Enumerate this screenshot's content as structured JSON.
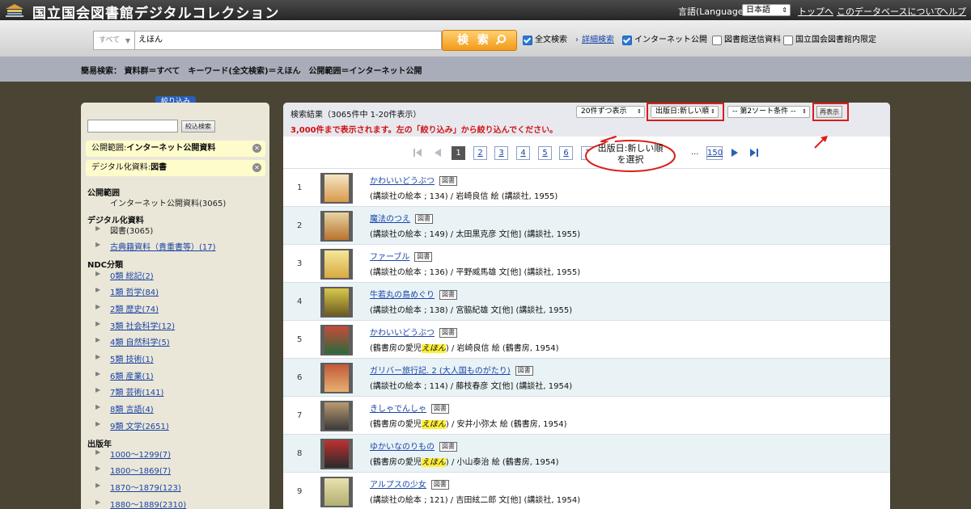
{
  "header": {
    "site_title": "国立国会図書館デジタルコレクション",
    "language_label": "言語(Language):",
    "language_value": "日本語",
    "links": [
      "トップへ",
      "このデータベースについて",
      "ヘルプ"
    ]
  },
  "search": {
    "scope": "すべて",
    "keyword": "えほん",
    "button": "検 索",
    "fulltext_label": "全文検索",
    "advanced_label": "詳細検索",
    "options": [
      {
        "label": "インターネット公開",
        "checked": true
      },
      {
        "label": "図書館送信資料",
        "checked": false
      },
      {
        "label": "国立国会図書館内限定",
        "checked": false
      }
    ]
  },
  "breadcrumb": "簡易検索： 資料群＝すべて　キーワード(全文検索)＝えほん　公開範囲＝インターネット公開",
  "sidebar": {
    "tab": "絞り込み",
    "narrow_button": "絞込検索",
    "chips": [
      {
        "prefix": "公開範囲:",
        "value": "インターネット公開資料"
      },
      {
        "prefix": "デジタル化資料:",
        "value": "図書"
      }
    ],
    "scope_heading": "公開範囲",
    "scope_item": "インターネット公開資料(3065)",
    "digital_heading": "デジタル化資料",
    "digital_items": [
      "図書(3065)",
      "古典籍資料（貴重書等）(17)"
    ],
    "ndc_heading": "NDC分類",
    "ndc_items": [
      "0類 総記(2)",
      "1類 哲学(84)",
      "2類 歴史(74)",
      "3類 社会科学(12)",
      "4類 自然科学(5)",
      "5類 技術(1)",
      "6類 産業(1)",
      "7類 芸術(141)",
      "8類 言語(4)",
      "9類 文学(2651)"
    ],
    "year_heading": "出版年",
    "year_items": [
      "1000～1299(7)",
      "1800～1869(7)",
      "1870～1879(123)",
      "1880～1889(2310)"
    ]
  },
  "results": {
    "count": "検索結果（3065件中 1-20件表示）",
    "warning": "3,000件まで表示されます。左の「絞り込み」から絞り込んでください。",
    "per_page": "20件ずつ表示",
    "sort": "出版日:新しい順",
    "sort2": "-- 第2ソート条件 --",
    "redisplay": "再表示",
    "callout": "出版日:新しい順\nを選択",
    "pages": [
      "1",
      "2",
      "3",
      "4",
      "5",
      "6",
      "7"
    ],
    "last_page": "150",
    "ellipsis": "...",
    "items": [
      {
        "num": "1",
        "title": "かわいいどうぶつ",
        "badge": "図書",
        "desc_pre": "(講談社の絵本 ; 134) / 岩崎良信 絵 (講談社, 1955)",
        "hl": "",
        "desc_post": ""
      },
      {
        "num": "2",
        "title": "魔法のつえ",
        "badge": "図書",
        "desc_pre": "(講談社の絵本 ; 149) / 太田黒克彦 文[他] (講談社, 1955)",
        "hl": "",
        "desc_post": ""
      },
      {
        "num": "3",
        "title": "ファーブル",
        "badge": "図書",
        "desc_pre": "(講談社の絵本 ; 136) / 平野威馬雄 文[他] (講談社, 1955)",
        "hl": "",
        "desc_post": ""
      },
      {
        "num": "4",
        "title": "牛若丸の島めぐり",
        "badge": "図書",
        "desc_pre": "(講談社の絵本 ; 138) / 宮脇紀雄 文[他] (講談社, 1955)",
        "hl": "",
        "desc_post": ""
      },
      {
        "num": "5",
        "title": "かわいいどうぶつ",
        "badge": "図書",
        "desc_pre": "(鶴書房の愛児",
        "hl": "えほん",
        "desc_post": ") / 岩崎良信 絵 (鶴書房, 1954)"
      },
      {
        "num": "6",
        "title": "ガリバー旅行記. 2 (大人国ものがたり)",
        "badge": "図書",
        "desc_pre": "(講談社の絵本 ; 114) / 藤枝春彦 文[他] (講談社, 1954)",
        "hl": "",
        "desc_post": ""
      },
      {
        "num": "7",
        "title": "きしゃでんしゃ",
        "badge": "図書",
        "desc_pre": "(鶴書房の愛児",
        "hl": "えほん",
        "desc_post": ") / 安井小弥太 絵 (鶴書房, 1954)"
      },
      {
        "num": "8",
        "title": "ゆかいなのりもの",
        "badge": "図書",
        "desc_pre": "(鶴書房の愛児",
        "hl": "えほん",
        "desc_post": ") / 小山泰治 絵 (鶴書房, 1954)"
      },
      {
        "num": "9",
        "title": "アルプスの少女",
        "badge": "図書",
        "desc_pre": "(講談社の絵本 ; 121) / 吉田絃二郎 文[他] (講談社, 1954)",
        "hl": "",
        "desc_post": ""
      }
    ]
  },
  "colors": {
    "accent": "#f39a18",
    "link": "#1a44a8",
    "warning": "#d01010",
    "highlight_box": "#d8201a"
  }
}
